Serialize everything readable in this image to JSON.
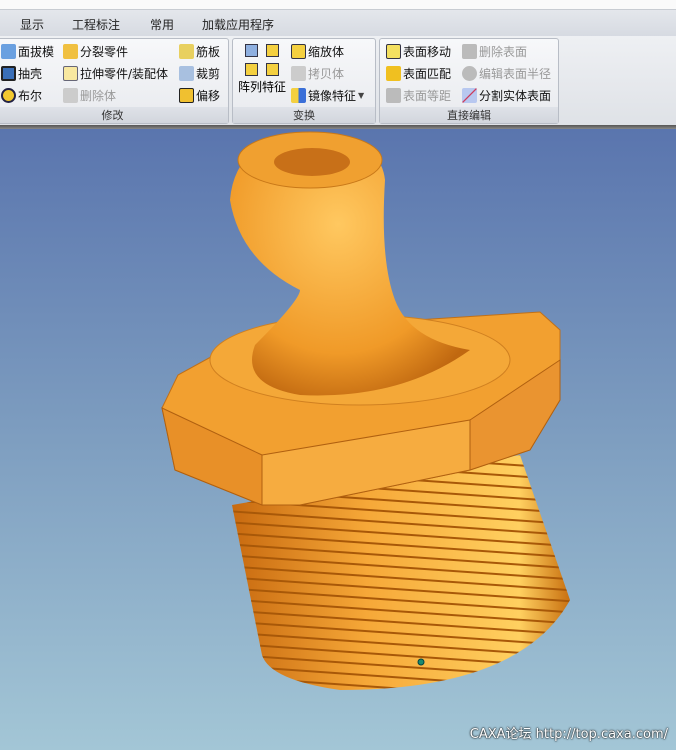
{
  "tabs": [
    "显示",
    "工程标注",
    "常用",
    "加载应用程序"
  ],
  "groups": {
    "modify": {
      "title": "修改",
      "buttons": [
        "面拔模",
        "抽壳",
        "布尔",
        "分裂零件",
        "拉伸零件/装配体",
        "删除体",
        "筋板",
        "裁剪",
        "偏移"
      ]
    },
    "transform": {
      "title": "变换",
      "pattern": "阵列特征",
      "buttons": [
        "缩放体",
        "拷贝体",
        "镜像特征"
      ]
    },
    "direct": {
      "title": "直接编辑",
      "buttons": [
        "表面移动",
        "表面匹配",
        "表面等距",
        "删除表面",
        "编辑表面半径",
        "分割实体表面"
      ]
    }
  },
  "watermark": "CAXA论坛 http://top.caxa.com/",
  "colors": {
    "part": "#f0a030",
    "bg_top": "#5a75ae",
    "bg_bottom": "#a3c6d6"
  }
}
